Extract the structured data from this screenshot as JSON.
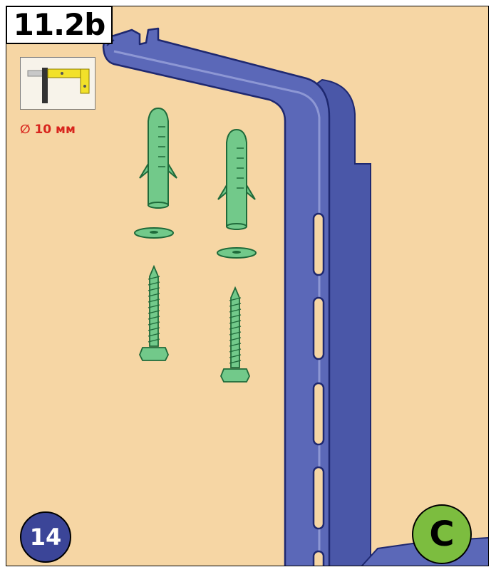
{
  "step": {
    "label": "11.2b"
  },
  "drill": {
    "size_label": "∅ 10 мм"
  },
  "page_number": "14",
  "part_letter": "C",
  "colors": {
    "background": "#f6d6a4",
    "bracket": "#5b68b8",
    "bracket_dark": "#2a3580",
    "fastener": "#72c98a",
    "fastener_dark": "#1f6a3a",
    "drill_size_red": "#d8251d",
    "badge_blue": "#3b4598",
    "badge_green": "#7cbd3f"
  },
  "parts": {
    "dowels": 2,
    "washers": 2,
    "screws": 2
  }
}
